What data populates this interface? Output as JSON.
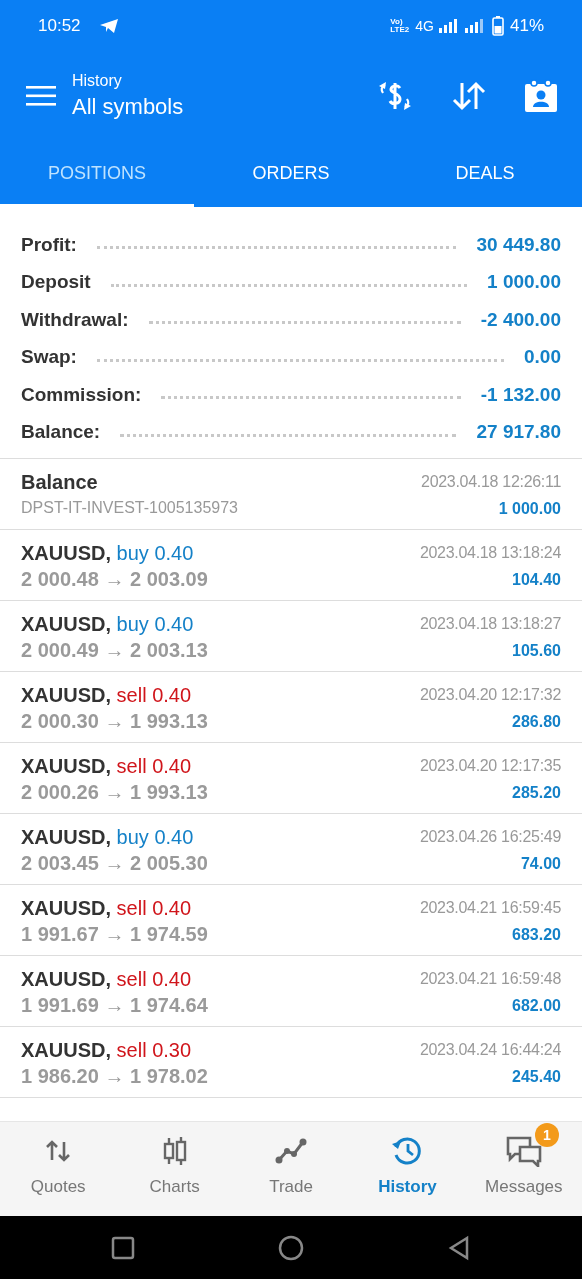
{
  "status_bar": {
    "time": "10:52",
    "volte_top": "Vo)",
    "volte_bottom": "LTE2",
    "network": "4G",
    "battery": "41%"
  },
  "app_bar": {
    "subtitle": "History",
    "title": "All symbols"
  },
  "tabs": [
    {
      "label": "POSITIONS",
      "selected": true
    },
    {
      "label": "ORDERS",
      "selected": false
    },
    {
      "label": "DEALS",
      "selected": false
    }
  ],
  "summary": [
    {
      "label": "Profit:",
      "value": "30 449.80"
    },
    {
      "label": "Deposit",
      "value": "1 000.00"
    },
    {
      "label": "Withdrawal:",
      "value": "-2 400.00"
    },
    {
      "label": "Swap:",
      "value": "0.00"
    },
    {
      "label": "Commission:",
      "value": "-1 132.00"
    },
    {
      "label": "Balance:",
      "value": "27 917.80"
    }
  ],
  "deals": [
    {
      "kind": "balance",
      "title": "Balance",
      "comment": "DPST-IT-INVEST-1005135973",
      "time": "2023.04.18 12:26:11",
      "amount": "1 000.00"
    },
    {
      "kind": "trade",
      "symbol": "XAUUSD,",
      "side": "buy",
      "volume": "0.40",
      "color": "#1481c8",
      "prices": "2 000.48 → 2 003.09",
      "time": "2023.04.18 13:18:24",
      "amount": "104.40"
    },
    {
      "kind": "trade",
      "symbol": "XAUUSD,",
      "side": "buy",
      "volume": "0.40",
      "color": "#1481c8",
      "prices": "2 000.49 → 2 003.13",
      "time": "2023.04.18 13:18:27",
      "amount": "105.60"
    },
    {
      "kind": "trade",
      "symbol": "XAUUSD,",
      "side": "sell",
      "volume": "0.40",
      "color": "#d0151b",
      "prices": "2 000.30 → 1 993.13",
      "time": "2023.04.20 12:17:32",
      "amount": "286.80"
    },
    {
      "kind": "trade",
      "symbol": "XAUUSD,",
      "side": "sell",
      "volume": "0.40",
      "color": "#d0151b",
      "prices": "2 000.26 → 1 993.13",
      "time": "2023.04.20 12:17:35",
      "amount": "285.20"
    },
    {
      "kind": "trade",
      "symbol": "XAUUSD,",
      "side": "buy",
      "volume": "0.40",
      "color": "#1481c8",
      "prices": "2 003.45 → 2 005.30",
      "time": "2023.04.26 16:25:49",
      "amount": "74.00"
    },
    {
      "kind": "trade",
      "symbol": "XAUUSD,",
      "side": "sell",
      "volume": "0.40",
      "color": "#d0151b",
      "prices": "1 991.67 → 1 974.59",
      "time": "2023.04.21 16:59:45",
      "amount": "683.20"
    },
    {
      "kind": "trade",
      "symbol": "XAUUSD,",
      "side": "sell",
      "volume": "0.40",
      "color": "#d0151b",
      "prices": "1 991.69 → 1 974.64",
      "time": "2023.04.21 16:59:48",
      "amount": "682.00"
    },
    {
      "kind": "trade",
      "symbol": "XAUUSD,",
      "side": "sell",
      "volume": "0.30",
      "color": "#d0151b",
      "prices": "1 986.20 → 1 978.02",
      "time": "2023.04.24 16:44:24",
      "amount": "245.40"
    }
  ],
  "bottom_nav": [
    {
      "kind": "quotes",
      "label": "Quotes",
      "selected": false
    },
    {
      "kind": "charts",
      "label": "Charts",
      "selected": false
    },
    {
      "kind": "trade",
      "label": "Trade",
      "selected": false
    },
    {
      "kind": "history",
      "label": "History",
      "selected": true
    },
    {
      "kind": "messages",
      "label": "Messages",
      "selected": false,
      "badge": "1"
    }
  ]
}
